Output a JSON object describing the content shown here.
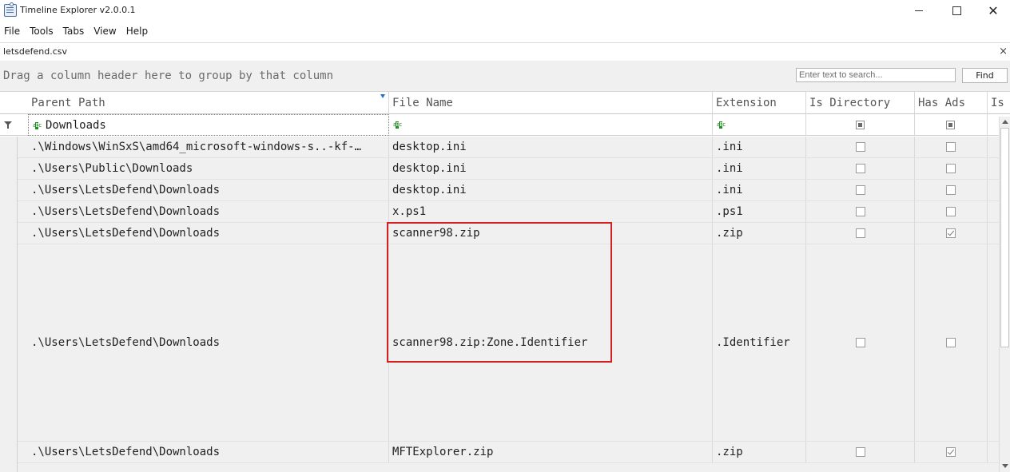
{
  "window": {
    "title": "Timeline Explorer v2.0.0.1",
    "app_icon": "timeline-app-icon"
  },
  "menu": [
    "File",
    "Tools",
    "Tabs",
    "View",
    "Help"
  ],
  "tab": {
    "label": "letsdefend.csv",
    "close_glyph": "×"
  },
  "groupbar": {
    "hint": "Drag a column header here to group by that column",
    "search_placeholder": "Enter text to search...",
    "find_label": "Find"
  },
  "columns": [
    "Parent Path",
    "File Name",
    "Extension",
    "Is Directory",
    "Has Ads",
    "Is"
  ],
  "filter": {
    "parent_path": "Downloads"
  },
  "rows": [
    {
      "parent_path": ".\\Windows\\WinSxS\\amd64_microsoft-windows-s..-kf-…",
      "file_name": "desktop.ini",
      "extension": ".ini",
      "is_directory": false,
      "has_ads": false
    },
    {
      "parent_path": ".\\Users\\Public\\Downloads",
      "file_name": "desktop.ini",
      "extension": ".ini",
      "is_directory": false,
      "has_ads": false
    },
    {
      "parent_path": ".\\Users\\LetsDefend\\Downloads",
      "file_name": "desktop.ini",
      "extension": ".ini",
      "is_directory": false,
      "has_ads": false
    },
    {
      "parent_path": ".\\Users\\LetsDefend\\Downloads",
      "file_name": "x.ps1",
      "extension": ".ps1",
      "is_directory": false,
      "has_ads": false
    },
    {
      "parent_path": ".\\Users\\LetsDefend\\Downloads",
      "file_name": "scanner98.zip",
      "extension": ".zip",
      "is_directory": false,
      "has_ads": true
    },
    {
      "parent_path": ".\\Users\\LetsDefend\\Downloads",
      "file_name": "scanner98.zip:Zone.Identifier",
      "extension": ".Identifier",
      "is_directory": false,
      "has_ads": false
    },
    {
      "parent_path": ".\\Users\\LetsDefend\\Downloads",
      "file_name": "MFTExplorer.zip",
      "extension": ".zip",
      "is_directory": false,
      "has_ads": true
    }
  ],
  "highlight_color": "#d42020"
}
